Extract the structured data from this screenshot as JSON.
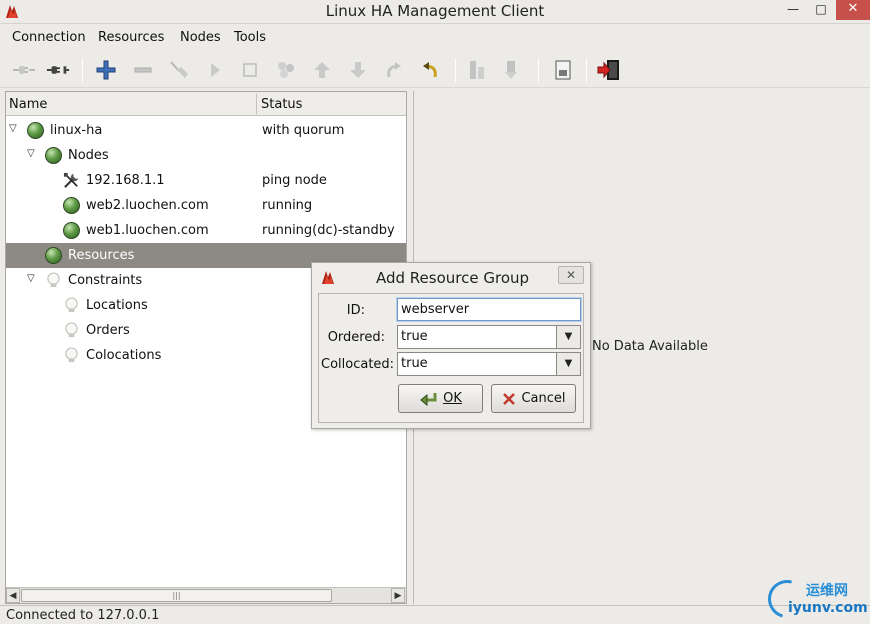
{
  "window": {
    "title": "Linux HA Management Client",
    "min_glyph": "—",
    "max_glyph": "□",
    "close_glyph": "✕"
  },
  "menu": {
    "items": [
      "Connection",
      "Resources",
      "Nodes",
      "Tools"
    ]
  },
  "toolbar": {
    "icons": [
      "connect-icon",
      "disconnect-icon",
      "add-icon",
      "remove-icon",
      "cleanup-icon",
      "start-icon",
      "stop-icon",
      "migrate-icon",
      "move-up-icon",
      "move-down-icon",
      "redo-icon",
      "undo-icon",
      "standby-icon",
      "active-icon",
      "view-xml-icon",
      "exit-icon"
    ]
  },
  "tree": {
    "columns": {
      "name": "Name",
      "status": "Status"
    },
    "rows": [
      {
        "label": "linux-ha",
        "status": "with quorum",
        "icon": "green-ball-icon"
      },
      {
        "label": "Nodes",
        "status": "",
        "icon": "green-ball-icon"
      },
      {
        "label": "192.168.1.1",
        "status": "ping node",
        "icon": "tools-icon"
      },
      {
        "label": "web2.luochen.com",
        "status": "running",
        "icon": "green-ball-icon"
      },
      {
        "label": "web1.luochen.com",
        "status": "running(dc)-standby",
        "icon": "green-ball-icon"
      },
      {
        "label": "Resources",
        "status": "",
        "icon": "green-ball-icon"
      },
      {
        "label": "Constraints",
        "status": "",
        "icon": "lightbulb-icon"
      },
      {
        "label": "Locations",
        "status": "",
        "icon": "lightbulb-icon"
      },
      {
        "label": "Orders",
        "status": "",
        "icon": "lightbulb-icon"
      },
      {
        "label": "Colocations",
        "status": "",
        "icon": "lightbulb-icon"
      }
    ],
    "expander_open": "▽",
    "scroll_left": "◀",
    "scroll_right": "▶",
    "scroll_grip": "|||"
  },
  "right_panel": {
    "message": "No Data Available"
  },
  "dialog": {
    "title": "Add Resource Group",
    "close_glyph": "✕",
    "id_label": "ID:",
    "id_value": "webserver",
    "ordered_label": "Ordered:",
    "ordered_value": "true",
    "collocated_label": "Collocated:",
    "collocated_value": "true",
    "combo_arrow": "▼",
    "ok_label": "OK",
    "cancel_label": "Cancel"
  },
  "statusbar": {
    "text": "Connected to 127.0.0.1"
  },
  "watermark": {
    "cn": "运维网",
    "en": "iyunv.com"
  },
  "colors": {
    "selection": "#8d8a84",
    "node_green": "#5f9b46",
    "close_red": "#c7504a"
  }
}
